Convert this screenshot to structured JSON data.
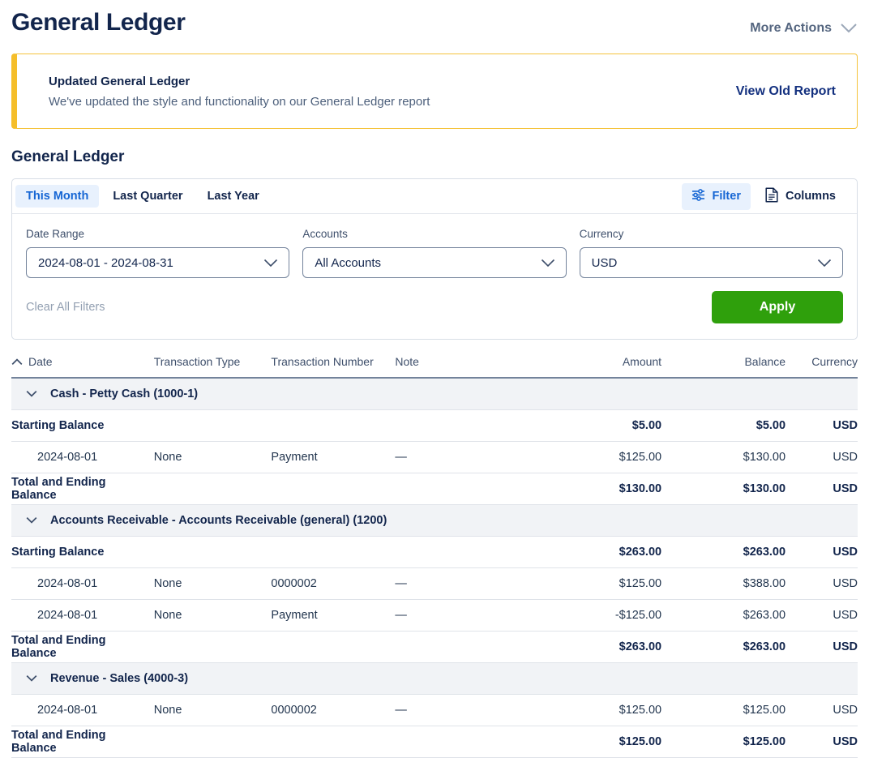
{
  "header": {
    "title": "General Ledger",
    "more_actions_label": "More Actions",
    "more_actions_icon": "chevron-down-icon"
  },
  "banner": {
    "title": "Updated General Ledger",
    "message": "We've updated the style and functionality on our General Ledger report",
    "link_label": "View Old Report",
    "accent_color": "#F5BE2A"
  },
  "report": {
    "section_title": "General Ledger"
  },
  "filters": {
    "tabs": [
      {
        "label": "This Month",
        "active": true
      },
      {
        "label": "Last Quarter",
        "active": false
      },
      {
        "label": "Last Year",
        "active": false
      }
    ],
    "filter_button": {
      "label": "Filter",
      "icon": "sliders-icon",
      "accent_color": "#1666D4"
    },
    "columns_button": {
      "label": "Columns",
      "icon": "document-icon"
    },
    "date_range": {
      "label": "Date Range",
      "value": "2024-08-01 - 2024-08-31",
      "icon": "chevron-down-icon"
    },
    "accounts": {
      "label": "Accounts",
      "value": "All Accounts",
      "icon": "chevron-down-icon"
    },
    "currency": {
      "label": "Currency",
      "value": "USD",
      "icon": "chevron-down-icon"
    },
    "clear_all_label": "Clear All Filters",
    "apply_label": "Apply",
    "apply_color": "#2FA00C"
  },
  "table": {
    "sort_icon": "chevron-up-icon",
    "columns": [
      "Date",
      "Transaction Type",
      "Transaction Number",
      "Note",
      "Amount",
      "Balance",
      "Currency"
    ],
    "groups": [
      {
        "name": "Cash - Petty Cash (1000-1)",
        "toggle_icon": "chevron-down-icon",
        "rows": [
          {
            "kind": "starting",
            "label": "Starting Balance",
            "date": "",
            "type": "",
            "number": "",
            "note": "",
            "amount": "$5.00",
            "balance": "$5.00",
            "currency": "USD"
          },
          {
            "kind": "txn",
            "label": "",
            "date": "2024-08-01",
            "type": "None",
            "number": "Payment",
            "note": "—",
            "amount": "$125.00",
            "balance": "$130.00",
            "currency": "USD"
          },
          {
            "kind": "total",
            "label": "Total and Ending Balance",
            "date": "",
            "type": "",
            "number": "",
            "note": "",
            "amount": "$130.00",
            "balance": "$130.00",
            "currency": "USD"
          }
        ]
      },
      {
        "name": "Accounts Receivable - Accounts Receivable (general) (1200)",
        "toggle_icon": "chevron-down-icon",
        "rows": [
          {
            "kind": "starting",
            "label": "Starting Balance",
            "date": "",
            "type": "",
            "number": "",
            "note": "",
            "amount": "$263.00",
            "balance": "$263.00",
            "currency": "USD"
          },
          {
            "kind": "txn",
            "label": "",
            "date": "2024-08-01",
            "type": "None",
            "number": "0000002",
            "note": "—",
            "amount": "$125.00",
            "balance": "$388.00",
            "currency": "USD"
          },
          {
            "kind": "txn",
            "label": "",
            "date": "2024-08-01",
            "type": "None",
            "number": "Payment",
            "note": "—",
            "amount": "-$125.00",
            "balance": "$263.00",
            "currency": "USD"
          },
          {
            "kind": "total",
            "label": "Total and Ending Balance",
            "date": "",
            "type": "",
            "number": "",
            "note": "",
            "amount": "$263.00",
            "balance": "$263.00",
            "currency": "USD"
          }
        ]
      },
      {
        "name": "Revenue - Sales (4000-3)",
        "toggle_icon": "chevron-down-icon",
        "rows": [
          {
            "kind": "txn",
            "label": "",
            "date": "2024-08-01",
            "type": "None",
            "number": "0000002",
            "note": "—",
            "amount": "$125.00",
            "balance": "$125.00",
            "currency": "USD"
          },
          {
            "kind": "total",
            "label": "Total and Ending Balance",
            "date": "",
            "type": "",
            "number": "",
            "note": "",
            "amount": "$125.00",
            "balance": "$125.00",
            "currency": "USD"
          }
        ]
      }
    ]
  }
}
